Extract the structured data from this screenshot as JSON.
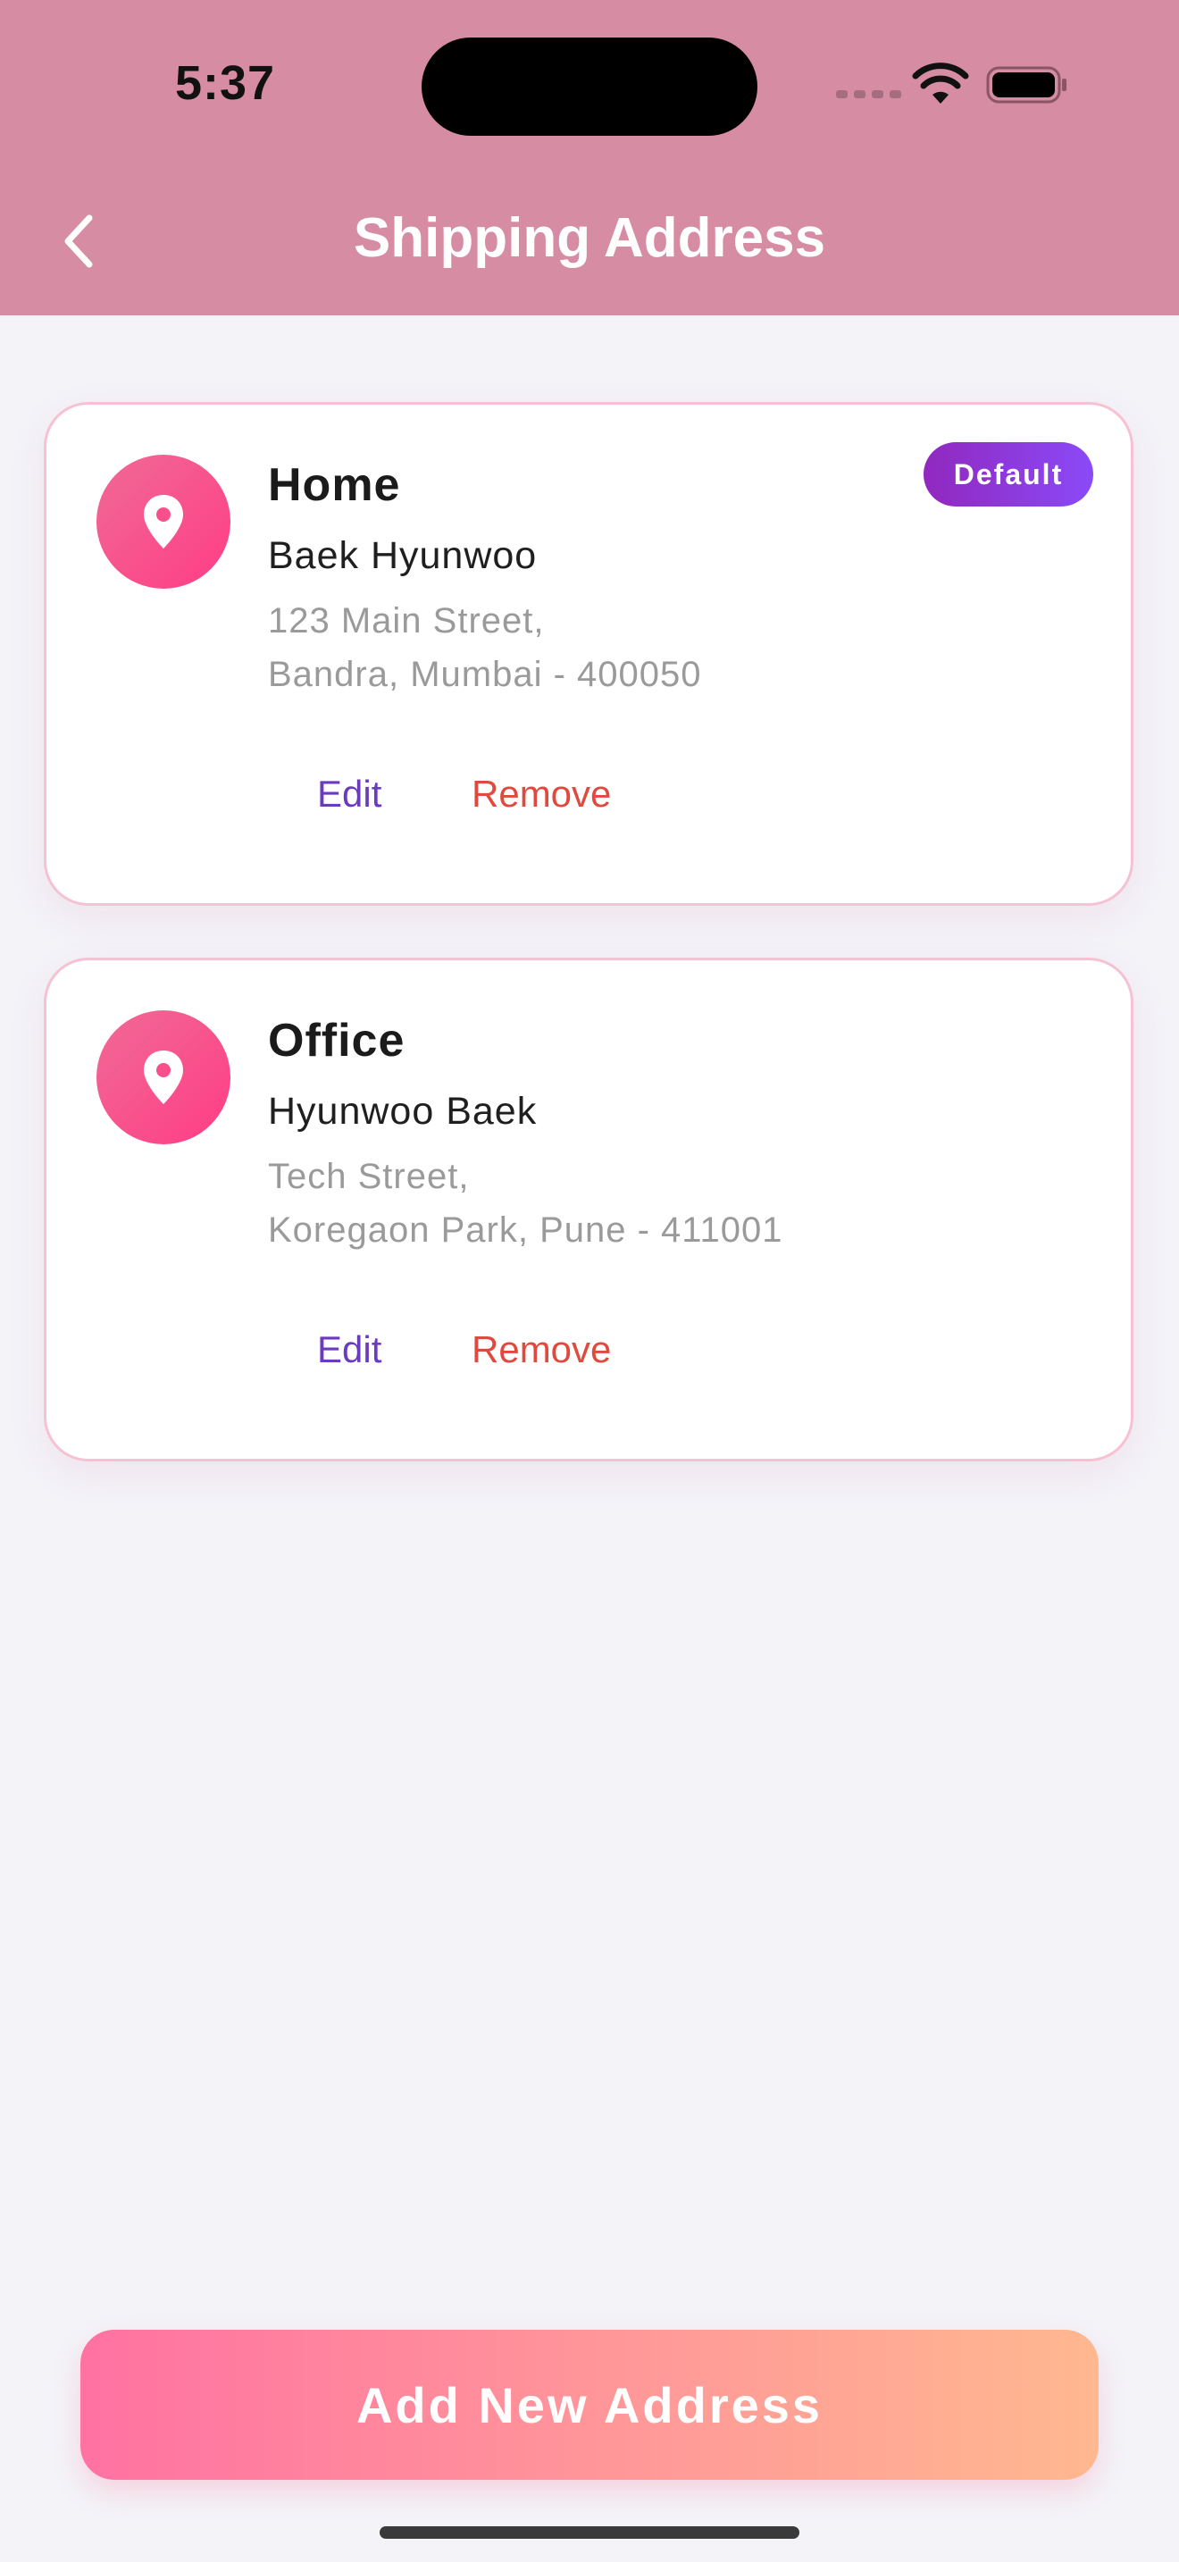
{
  "status_bar": {
    "time": "5:37"
  },
  "header": {
    "title": "Shipping Address",
    "back_icon": "chevron-left-icon"
  },
  "addresses": [
    {
      "label": "Home",
      "name": "Baek Hyunwoo",
      "line1": "123 Main Street,",
      "line2": "Bandra, Mumbai - 400050",
      "badge": "Default",
      "edit": "Edit",
      "remove": "Remove",
      "icon": "location-pin-icon"
    },
    {
      "label": "Office",
      "name": "Hyunwoo Baek",
      "line1": "Tech Street,",
      "line2": "Koregaon Park, Pune - 411001",
      "edit": "Edit",
      "remove": "Remove",
      "icon": "location-pin-icon"
    }
  ],
  "add_button": {
    "label": "Add New Address"
  },
  "colors": {
    "header_bg": "#d68ca3",
    "edit": "#6a3bbf",
    "remove": "#e04a3e",
    "pin_gradient": [
      "#f06a96",
      "#ff3d85"
    ],
    "button_gradient": [
      "#ff72a2",
      "#ffb890"
    ],
    "badge_gradient": [
      "#9128bf",
      "#8a4af7"
    ]
  }
}
